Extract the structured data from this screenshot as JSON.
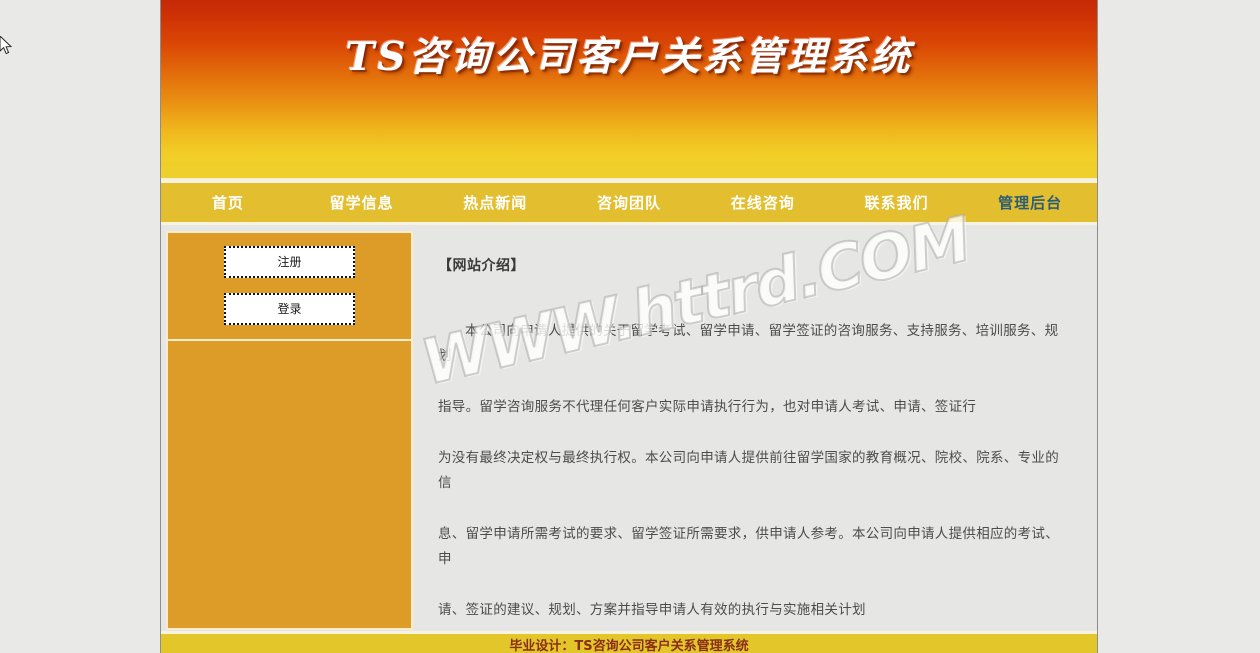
{
  "banner": {
    "title": "TS咨询公司客户关系管理系统"
  },
  "nav": {
    "items": [
      {
        "label": "首页",
        "name": "nav-item-home",
        "admin": false
      },
      {
        "label": "留学信息",
        "name": "nav-item-study-abroad-info",
        "admin": false
      },
      {
        "label": "热点新闻",
        "name": "nav-item-hot-news",
        "admin": false
      },
      {
        "label": "咨询团队",
        "name": "nav-item-consulting-team",
        "admin": false
      },
      {
        "label": "在线咨询",
        "name": "nav-item-online-consulting",
        "admin": false
      },
      {
        "label": "联系我们",
        "name": "nav-item-contact-us",
        "admin": false
      },
      {
        "label": "管理后台",
        "name": "nav-item-admin-backend",
        "admin": true
      }
    ]
  },
  "sidebar": {
    "register_label": "注册",
    "login_label": "登录"
  },
  "content": {
    "title": "【网站介绍】",
    "paragraphs": [
      "本公司向申请人提供的关于留学考试、留学申请、留学签证的咨询服务、支持服务、培训服务、规划",
      "指导。留学咨询服务不代理任何客户实际申请执行行为，也对申请人考试、申请、签证行",
      "为没有最终决定权与最终执行权。本公司向申请人提供前往留学国家的教育概况、院校、院系、专业的信",
      "息、留学申请所需考试的要求、留学签证所需要求，供申请人参考。本公司向申请人提供相应的考试、申",
      "请、签证的建议、规划、方案并指导申请人有效的执行与实施相关计划"
    ]
  },
  "watermark": {
    "text": "WWW.httrd.COM"
  },
  "footer": {
    "text": "毕业设计：TS咨询公司客户关系管理系统"
  },
  "colors": {
    "banner_top": "#c62a06",
    "banner_bottom": "#eed02c",
    "nav_bg": "#e3be2f",
    "nav_text": "#ffffff",
    "nav_admin_text": "#2d5d74",
    "sidebar_bg": "#dd9b28",
    "sidebar_border": "#f7eccb",
    "page_bg": "#e9e9e7",
    "content_bg": "#e6e6e4",
    "body_text": "#4c4c4c",
    "footer_bg": "#e3c62a",
    "footer_text": "#8a2f16"
  }
}
